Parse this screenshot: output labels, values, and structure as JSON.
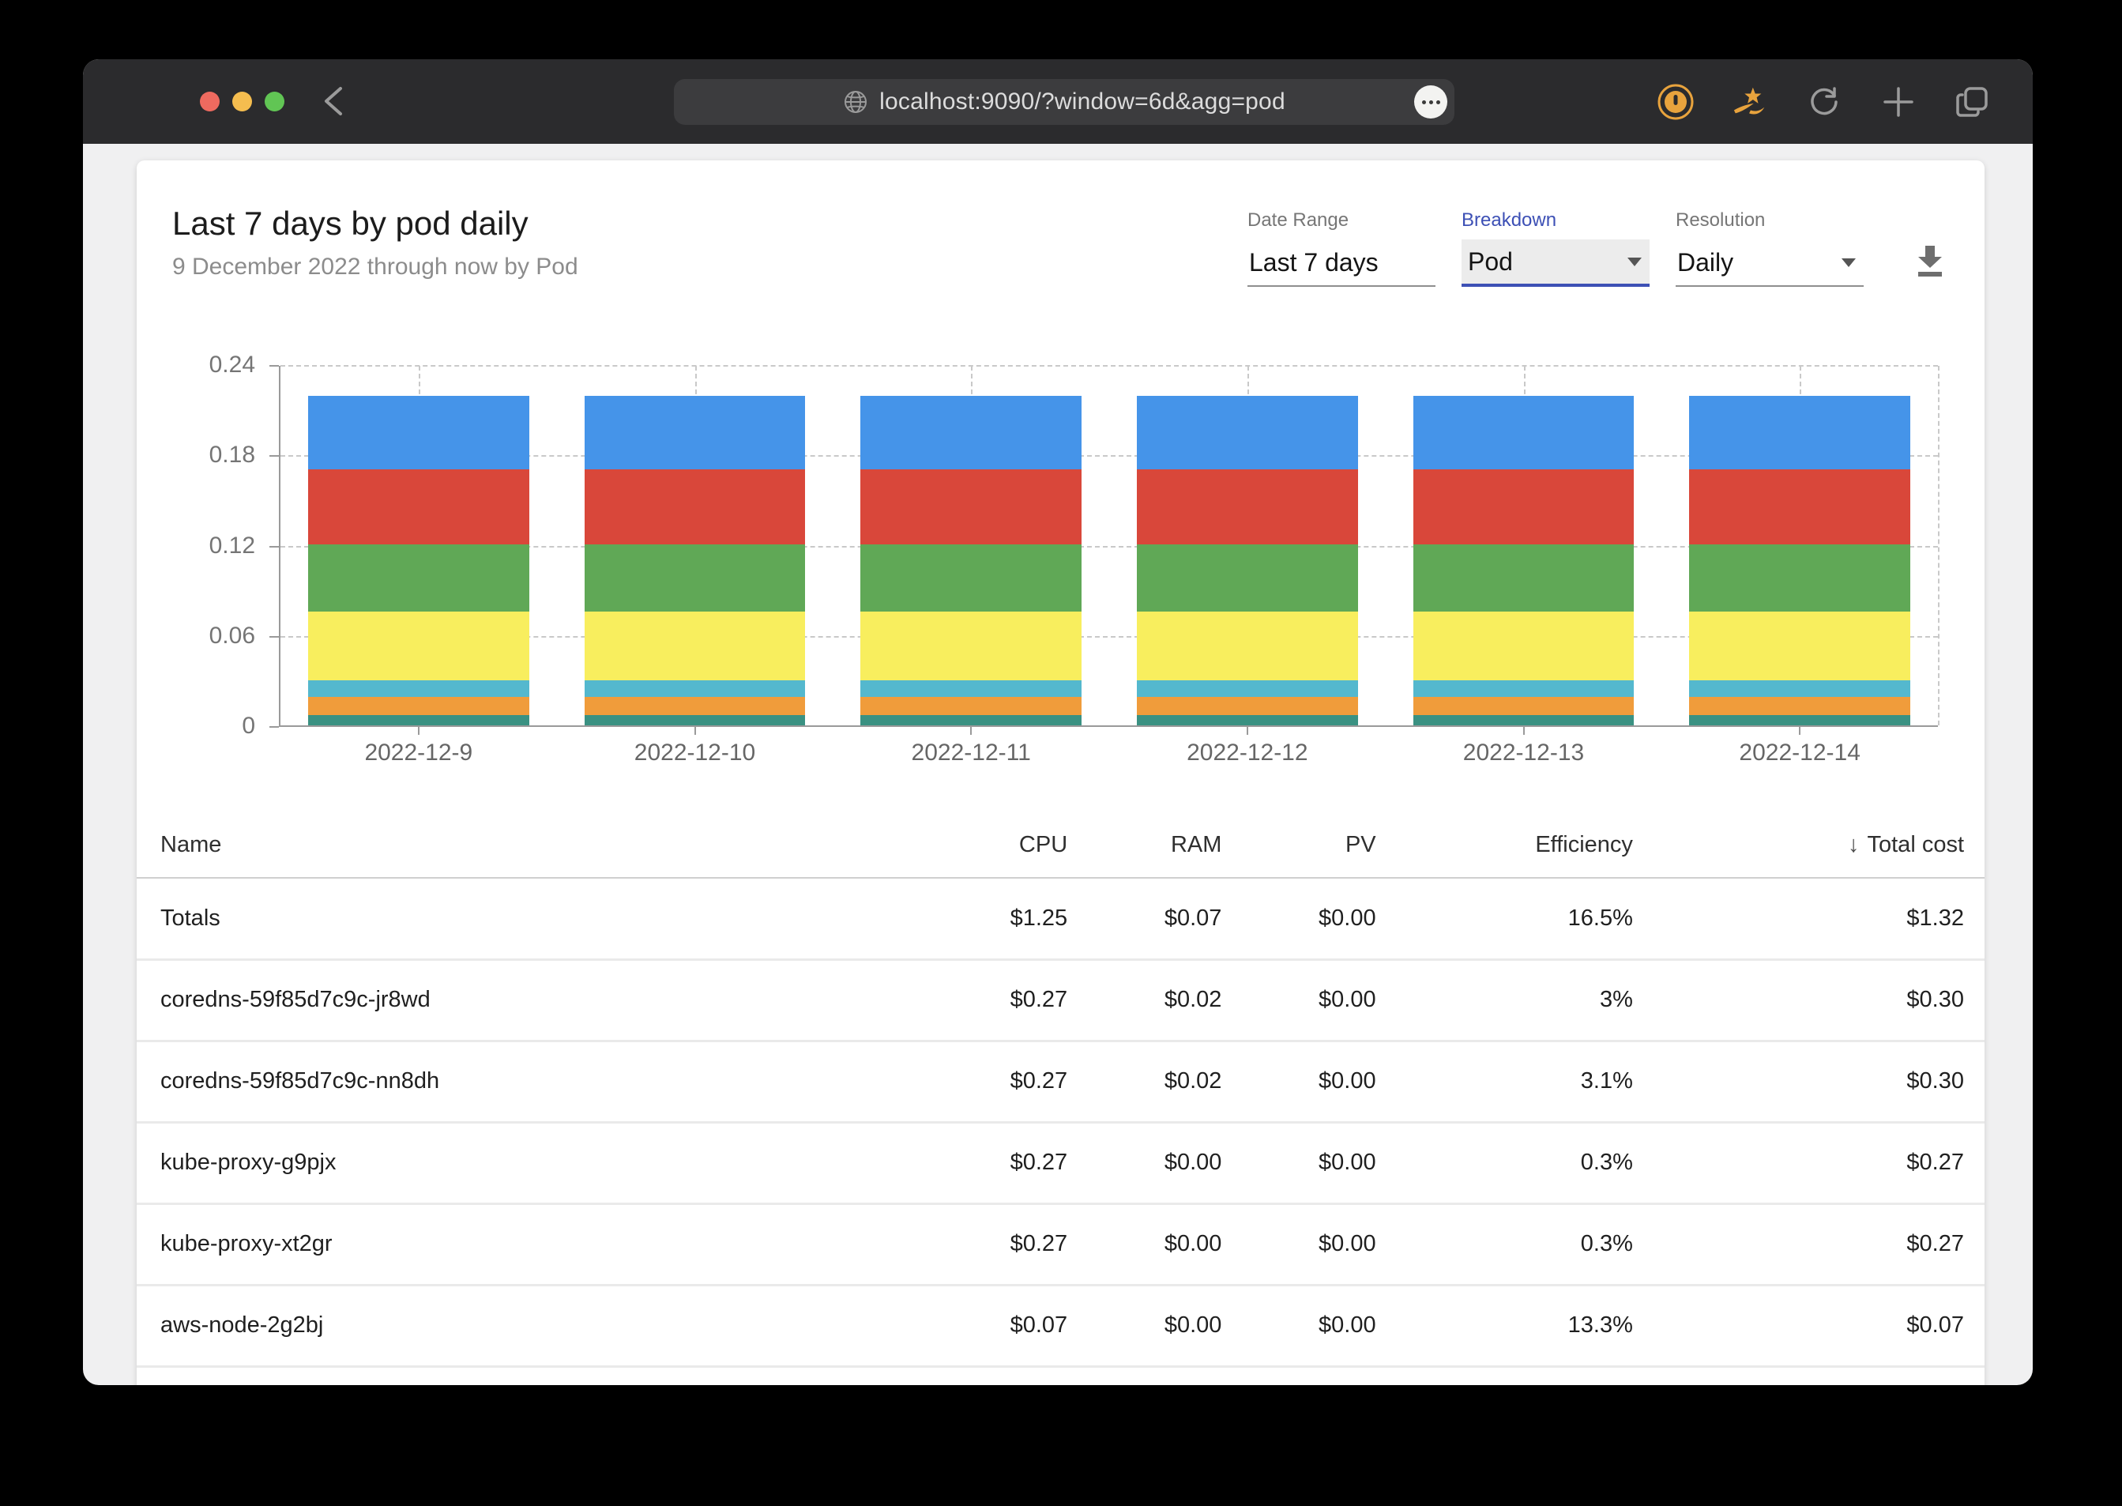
{
  "browser": {
    "url": "localhost:9090/?window=6d&agg=pod",
    "back_label": "back",
    "traffic_lights": [
      "close",
      "minimize",
      "zoom"
    ],
    "action_icons": [
      "password-manager-extension",
      "wand-extension",
      "reload",
      "new-tab",
      "tab-overview"
    ]
  },
  "page": {
    "title": "Last 7 days by pod daily",
    "subtitle": "9 December 2022 through now by Pod",
    "controls": {
      "date_range": {
        "label": "Date Range",
        "value": "Last 7 days"
      },
      "breakdown": {
        "label": "Breakdown",
        "value": "Pod"
      },
      "resolution": {
        "label": "Resolution",
        "value": "Daily"
      }
    },
    "accent_color": "#3D50B5"
  },
  "chart_data": {
    "type": "bar",
    "stacked": true,
    "title": "",
    "xlabel": "",
    "ylabel": "",
    "categories": [
      "2022-12-9",
      "2022-12-10",
      "2022-12-11",
      "2022-12-12",
      "2022-12-13",
      "2022-12-14"
    ],
    "series": [
      {
        "name": "teal-segment",
        "color": "#3A9182",
        "values": [
          0.007,
          0.007,
          0.007,
          0.007,
          0.007,
          0.007
        ]
      },
      {
        "name": "orange-segment",
        "color": "#F09C3B",
        "values": [
          0.012,
          0.012,
          0.012,
          0.012,
          0.012,
          0.012
        ]
      },
      {
        "name": "cyan-segment",
        "color": "#54B8CE",
        "values": [
          0.011,
          0.011,
          0.011,
          0.011,
          0.011,
          0.011
        ]
      },
      {
        "name": "yellow-segment",
        "color": "#F8EE5E",
        "values": [
          0.046,
          0.046,
          0.046,
          0.046,
          0.046,
          0.046
        ]
      },
      {
        "name": "green-segment",
        "color": "#60A856",
        "values": [
          0.045,
          0.045,
          0.045,
          0.045,
          0.045,
          0.045
        ]
      },
      {
        "name": "red-segment",
        "color": "#D9473A",
        "values": [
          0.05,
          0.05,
          0.05,
          0.05,
          0.05,
          0.05
        ]
      },
      {
        "name": "blue-segment",
        "color": "#4594E9",
        "values": [
          0.049,
          0.049,
          0.049,
          0.049,
          0.049,
          0.049
        ]
      }
    ],
    "ylim": [
      0,
      0.24
    ],
    "yticks": [
      0,
      0.06,
      0.12,
      0.18,
      0.24
    ],
    "ytick_labels": [
      "0",
      "0.06",
      "0.12",
      "0.18",
      "0.24"
    ],
    "grid": true,
    "legend_position": "none"
  },
  "table": {
    "columns": [
      "Name",
      "CPU",
      "RAM",
      "PV",
      "Efficiency",
      "Total cost"
    ],
    "sort_arrow": "↓",
    "sort_column": "Total cost",
    "rows": [
      {
        "name": "Totals",
        "cpu": "$1.25",
        "ram": "$0.07",
        "pv": "$0.00",
        "efficiency": "16.5%",
        "total": "$1.32"
      },
      {
        "name": "coredns-59f85d7c9c-jr8wd",
        "cpu": "$0.27",
        "ram": "$0.02",
        "pv": "$0.00",
        "efficiency": "3%",
        "total": "$0.30"
      },
      {
        "name": "coredns-59f85d7c9c-nn8dh",
        "cpu": "$0.27",
        "ram": "$0.02",
        "pv": "$0.00",
        "efficiency": "3.1%",
        "total": "$0.30"
      },
      {
        "name": "kube-proxy-g9pjx",
        "cpu": "$0.27",
        "ram": "$0.00",
        "pv": "$0.00",
        "efficiency": "0.3%",
        "total": "$0.27"
      },
      {
        "name": "kube-proxy-xt2gr",
        "cpu": "$0.27",
        "ram": "$0.00",
        "pv": "$0.00",
        "efficiency": "0.3%",
        "total": "$0.27"
      },
      {
        "name": "aws-node-2g2bj",
        "cpu": "$0.07",
        "ram": "$0.00",
        "pv": "$0.00",
        "efficiency": "13.3%",
        "total": "$0.07"
      }
    ]
  }
}
